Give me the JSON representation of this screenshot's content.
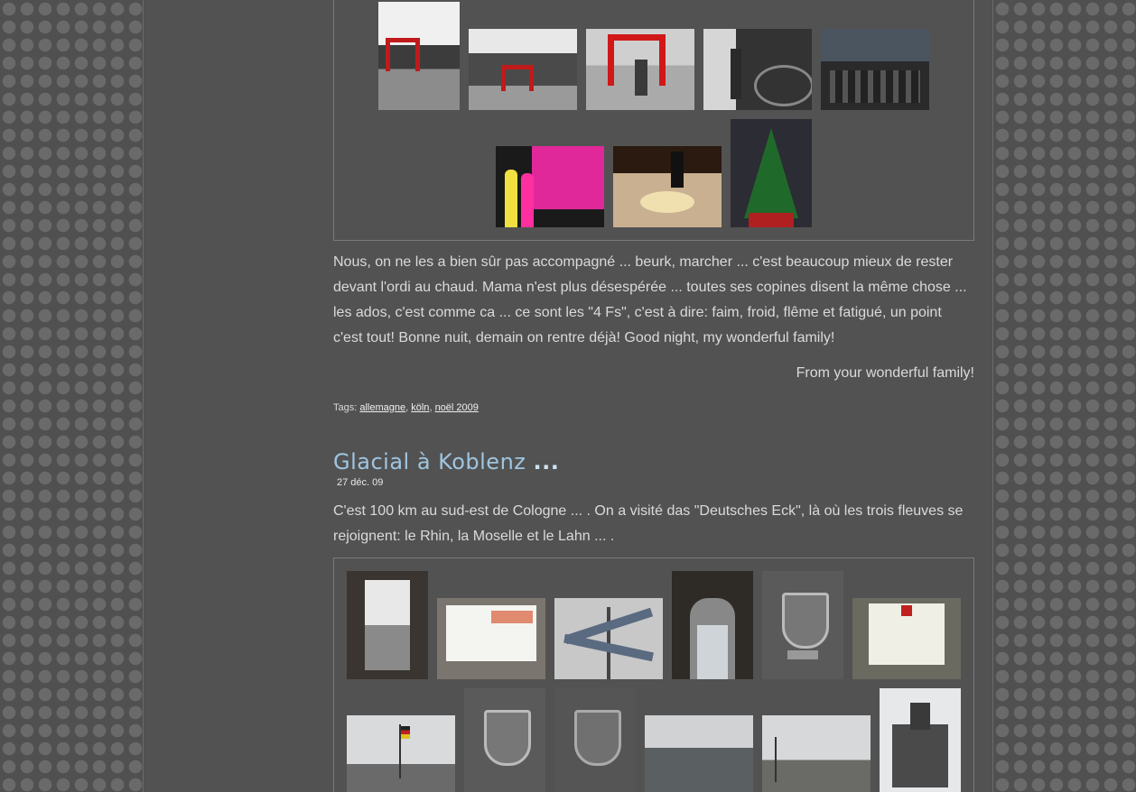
{
  "post1": {
    "paragraph": "Nous, on ne les a bien sûr pas accompagné ... beurk, marcher ... c'est beaucoup mieux de rester devant l'ordi au chaud. Mama n'est plus désespérée ... toutes ses copines disent la même chose ... les ados, c'est comme ca ... ce sont les \"4 Fs\", c'est à dire: faim, froid, flême et fatigué, un point c'est tout! Bonne nuit, demain on rentre déjà! Good night, my wonderful family!",
    "signoff": "From your wonderful family!",
    "tags_label": "Tags:",
    "tags": [
      "allemagne",
      "köln",
      "noël 2009"
    ]
  },
  "post2": {
    "title": "Glacial à Koblenz",
    "title_suffix": "...",
    "date": "27 déc. 09",
    "paragraph": "C'est 100 km au sud-est de Cologne ... . On a visité das \"Deutsches Eck\", là où les trois fleuves se rejoignent: le Rhin, la Moselle et le Lahn ... ."
  },
  "colors": {
    "background": "#505050",
    "title": "#9fc5e0",
    "text": "#dadada"
  }
}
